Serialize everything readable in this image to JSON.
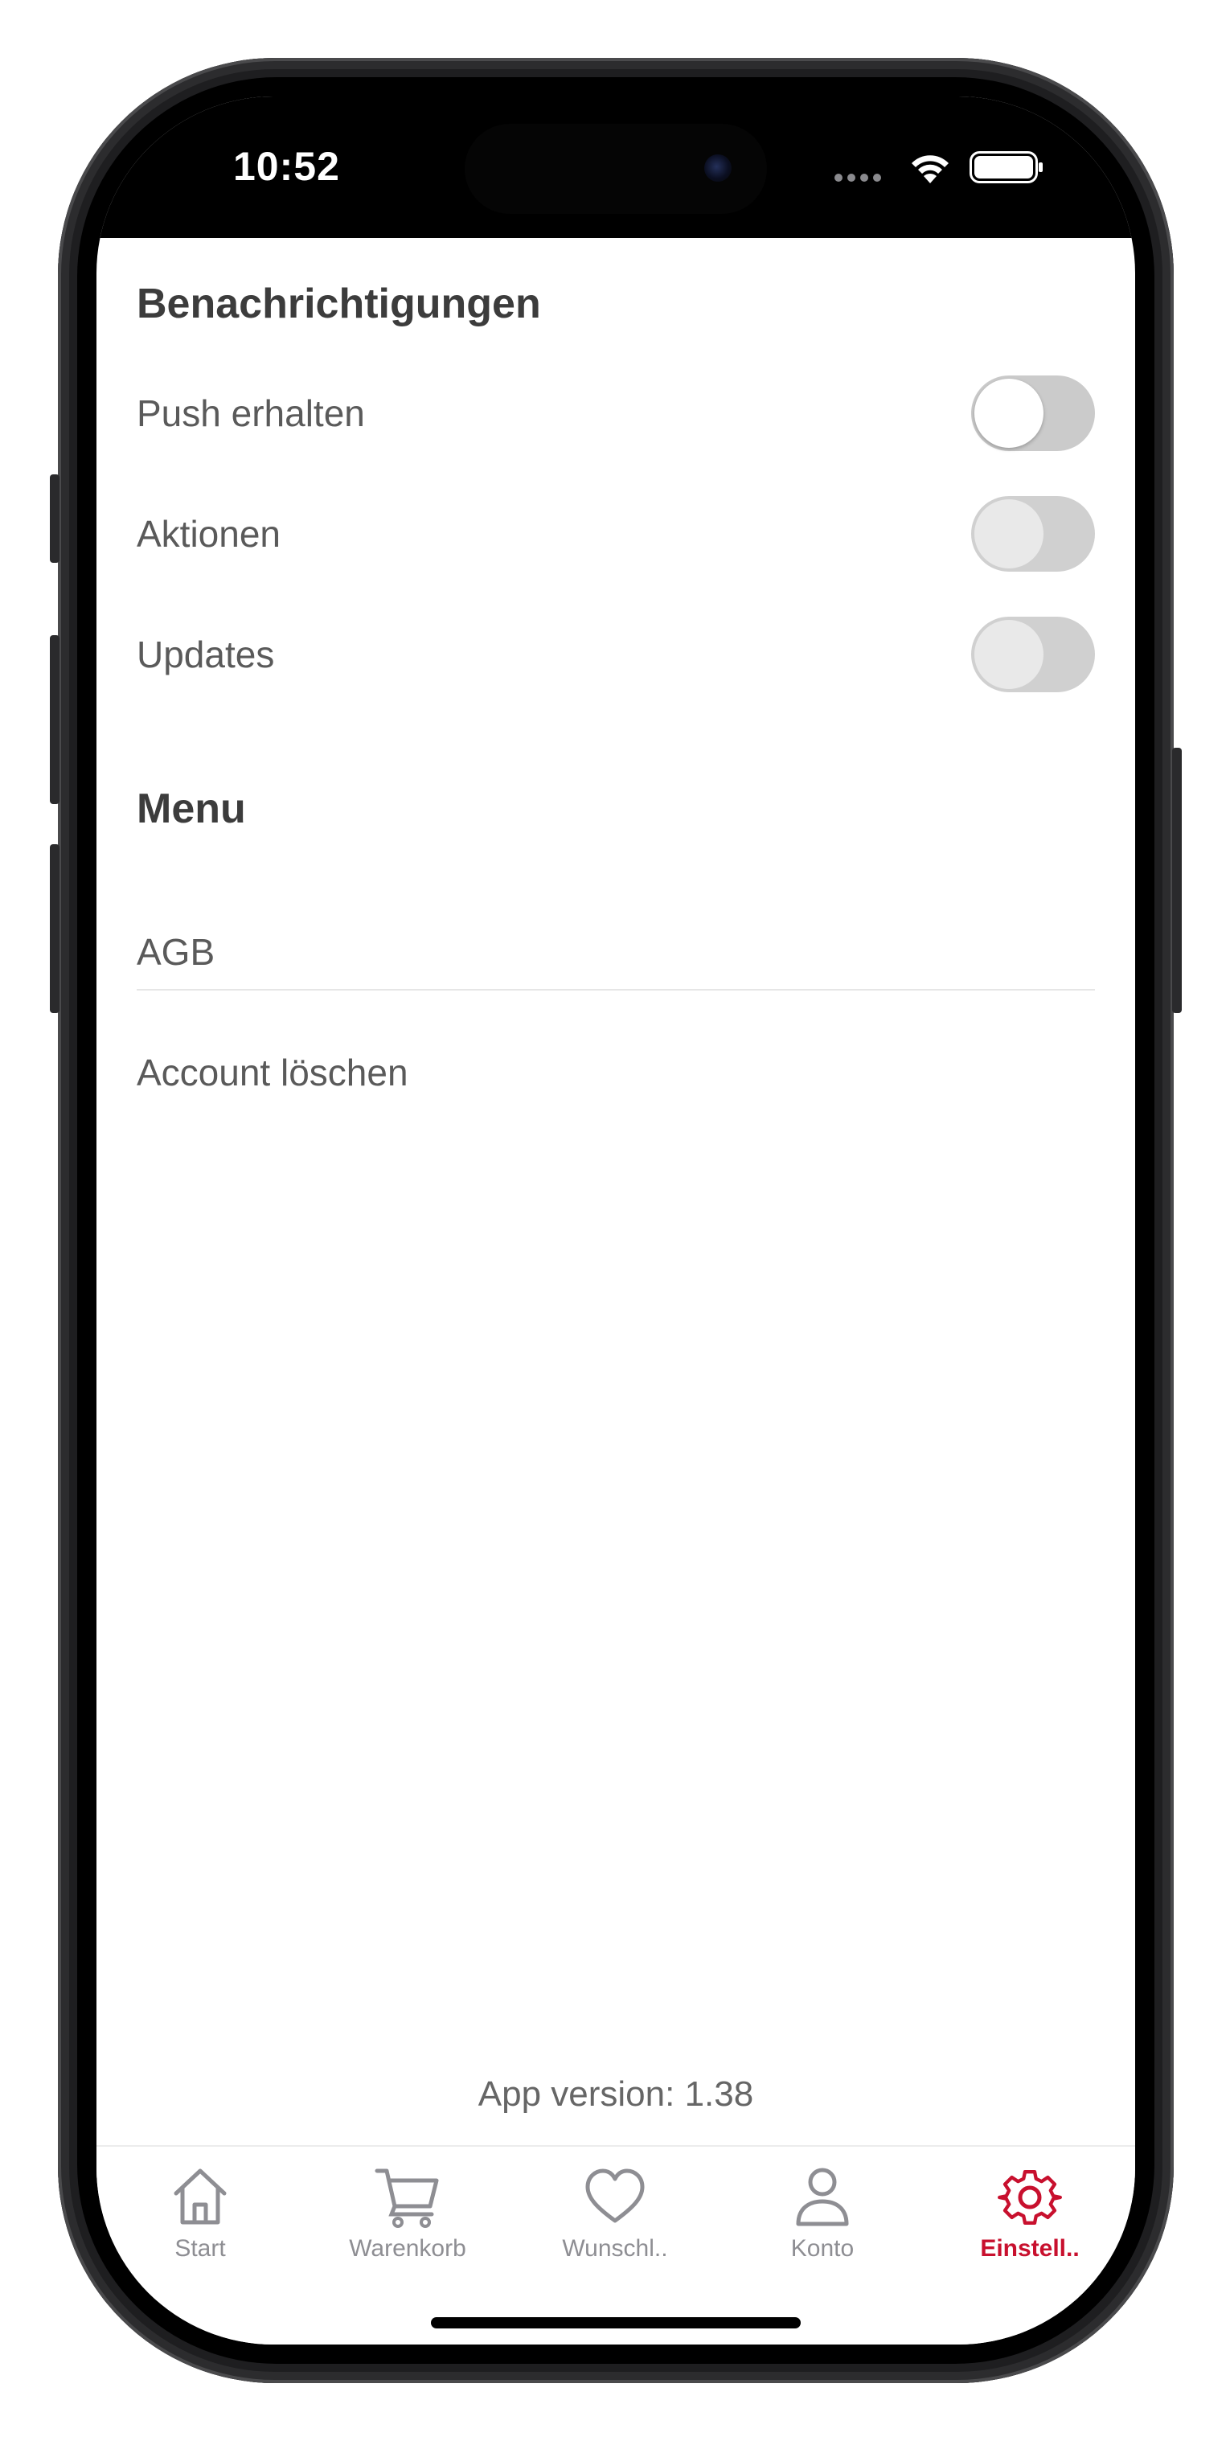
{
  "status_bar": {
    "time": "10:52"
  },
  "notifications": {
    "title": "Benachrichtigungen",
    "items": [
      {
        "label": "Push erhalten",
        "enabled": false
      },
      {
        "label": "Aktionen",
        "enabled": false
      },
      {
        "label": "Updates",
        "enabled": false
      }
    ]
  },
  "menu": {
    "title": "Menu",
    "items": [
      {
        "label": "AGB"
      },
      {
        "label": "Account löschen"
      }
    ]
  },
  "footer": {
    "app_version": "App version: 1.38"
  },
  "tab_bar": {
    "tabs": [
      {
        "label": "Start",
        "icon": "home-icon",
        "active": false
      },
      {
        "label": "Warenkorb",
        "icon": "cart-icon",
        "active": false
      },
      {
        "label": "Wunschl..",
        "icon": "heart-icon",
        "active": false
      },
      {
        "label": "Konto",
        "icon": "person-icon",
        "active": false
      },
      {
        "label": "Einstell..",
        "icon": "gear-icon",
        "active": true
      }
    ],
    "active_color": "#c8102e",
    "inactive_color": "#8e8e93"
  }
}
